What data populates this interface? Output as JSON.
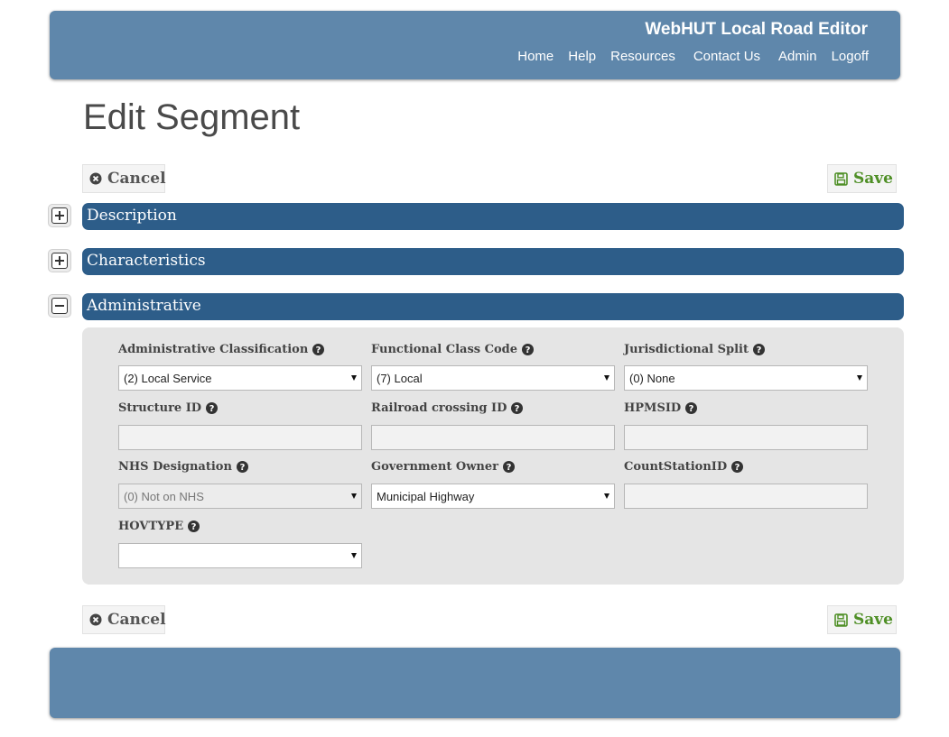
{
  "header": {
    "brand": "WebHUT Local Road Editor",
    "nav": [
      "Home",
      "Help",
      "Resources",
      "Contact Us",
      "Admin",
      "Logoff"
    ]
  },
  "page": {
    "title": "Edit Segment"
  },
  "actions": {
    "cancel_label": "Cancel",
    "save_label": "Save"
  },
  "sections": [
    {
      "label": "Description",
      "expanded": false
    },
    {
      "label": "Characteristics",
      "expanded": false
    },
    {
      "label": "Administrative",
      "expanded": true
    }
  ],
  "form": {
    "admin_class": {
      "label": "Administrative Classification",
      "value": "(2) Local Service"
    },
    "func_class": {
      "label": "Functional Class Code",
      "value": "(7) Local"
    },
    "juris_split": {
      "label": "Jurisdictional Split",
      "value": "(0) None"
    },
    "structure_id": {
      "label": "Structure ID",
      "value": ""
    },
    "railroad_id": {
      "label": "Railroad crossing ID",
      "value": ""
    },
    "hpmsid": {
      "label": "HPMSID",
      "value": ""
    },
    "nhs": {
      "label": "NHS Designation",
      "value": "(0) Not on NHS"
    },
    "gov_owner": {
      "label": "Government Owner",
      "value": "Municipal Highway"
    },
    "count_station": {
      "label": "CountStationID",
      "value": ""
    },
    "hovtype": {
      "label": "HOVTYPE",
      "value": ""
    }
  },
  "colors": {
    "header_bg": "#5f87ab",
    "section_bar": "#2d5d89",
    "save_green": "#4f8f26"
  }
}
